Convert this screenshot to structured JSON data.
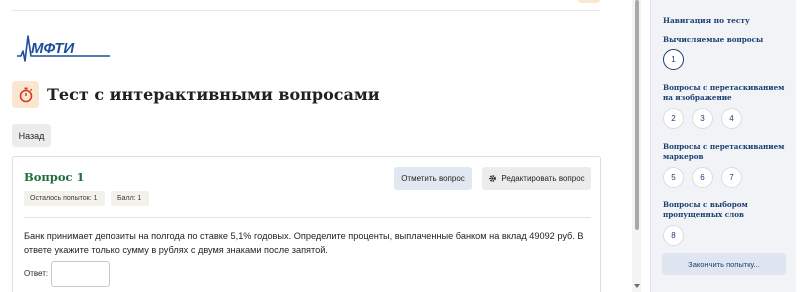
{
  "header": {
    "logo_text": "МФТИ",
    "page_title": "Тест с интерактивными вопросами",
    "back_label": "Назад"
  },
  "question": {
    "title": "Вопрос 1",
    "attempts_badge": "Осталось попыток: 1",
    "score_badge": "Балл: 1",
    "flag_label": "Отметить вопрос",
    "edit_label": "Редактировать вопрос",
    "text": "Банк принимает депозиты на полгода по ставке 5,1% годовых. Определите проценты, выплаченные банком на вклад 49092 руб. В ответе укажите только сумму в рублях с двумя знаками после запятой.",
    "answer_label": "Ответ:",
    "answer_value": ""
  },
  "nav": {
    "title": "Навигация по тесту",
    "sections": [
      {
        "label": "Вычисляемые вопросы",
        "buttons": [
          "1"
        ]
      },
      {
        "label": "Вопросы с перетаскиванием на изображение",
        "buttons": [
          "2",
          "3",
          "4"
        ]
      },
      {
        "label": "Вопросы с перетаскиванием маркеров",
        "buttons": [
          "5",
          "6",
          "7"
        ]
      },
      {
        "label": "Вопросы с выбором пропущенных слов",
        "buttons": [
          "8"
        ]
      }
    ],
    "current_question": "1",
    "finish_label": "Закончить попытку..."
  },
  "colors": {
    "brand_blue": "#1b3f73",
    "question_title_green": "#1e6e3a",
    "quiz_icon_bg": "#fbe6d2",
    "quiz_icon_red": "#d13b22",
    "logo_blue": "#1f4e9a"
  },
  "icons": {
    "quiz": "stopwatch-icon",
    "edit": "gear-icon"
  }
}
